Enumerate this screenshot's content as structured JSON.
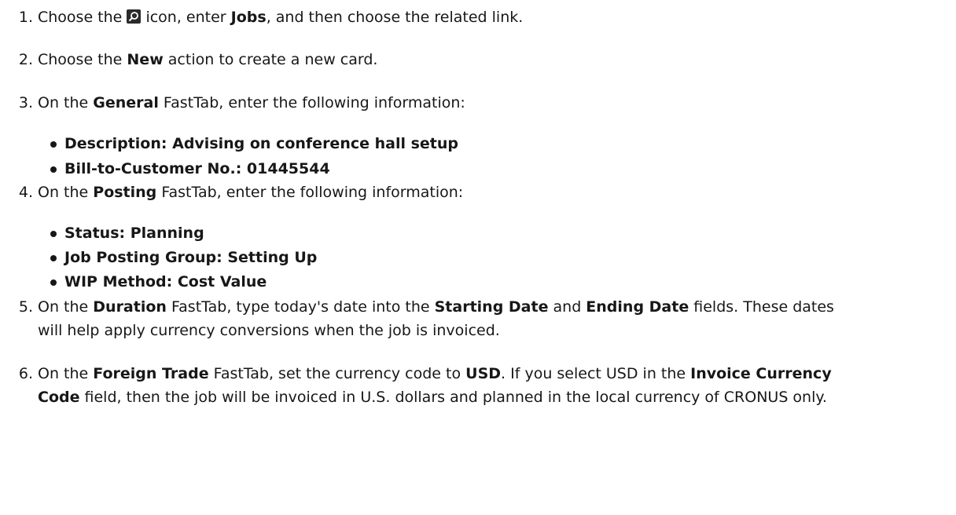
{
  "steps": [
    {
      "num": "1.",
      "pre": "Choose the ",
      "post_icon": " icon, enter ",
      "b1": "Jobs",
      "post": ", and then choose the related link."
    },
    {
      "num": "2.",
      "pre": "Choose the ",
      "b1": "New",
      "post": " action to create a new card."
    },
    {
      "num": "3.",
      "pre": "On the ",
      "b1": "General",
      "post": " FastTab, enter the following information:"
    },
    {
      "num": "4.",
      "pre": "On the ",
      "b1": "Posting",
      "post": " FastTab, enter the following information:"
    },
    {
      "num": "5.",
      "pre": "On the ",
      "b1": "Duration",
      "mid1": " FastTab, type today's date into the ",
      "b2": "Starting Date",
      "mid2": " and ",
      "b3": "Ending Date",
      "post": " fields. These dates",
      "cont": "will help apply currency conversions when the job is invoiced."
    },
    {
      "num": "6.",
      "pre": "On the ",
      "b1": "Foreign Trade",
      "mid1": " FastTab, set the currency code to ",
      "b2": "USD",
      "mid2": ". If you select USD in the ",
      "b3": "Invoice Currency",
      "cont_b": "Code",
      "cont": " field, then the job will be invoiced in U.S. dollars and planned in the local currency of CRONUS only."
    }
  ],
  "general_fields": [
    {
      "label": "Description",
      "value": "Advising on conference hall setup"
    },
    {
      "label": "Bill-to-Customer No.",
      "value": "01445544"
    }
  ],
  "posting_fields": [
    {
      "label": "Status",
      "value": "Planning"
    },
    {
      "label": "Job Posting Group",
      "value": "Setting Up"
    },
    {
      "label": "WIP Method",
      "value": "Cost Value"
    }
  ]
}
